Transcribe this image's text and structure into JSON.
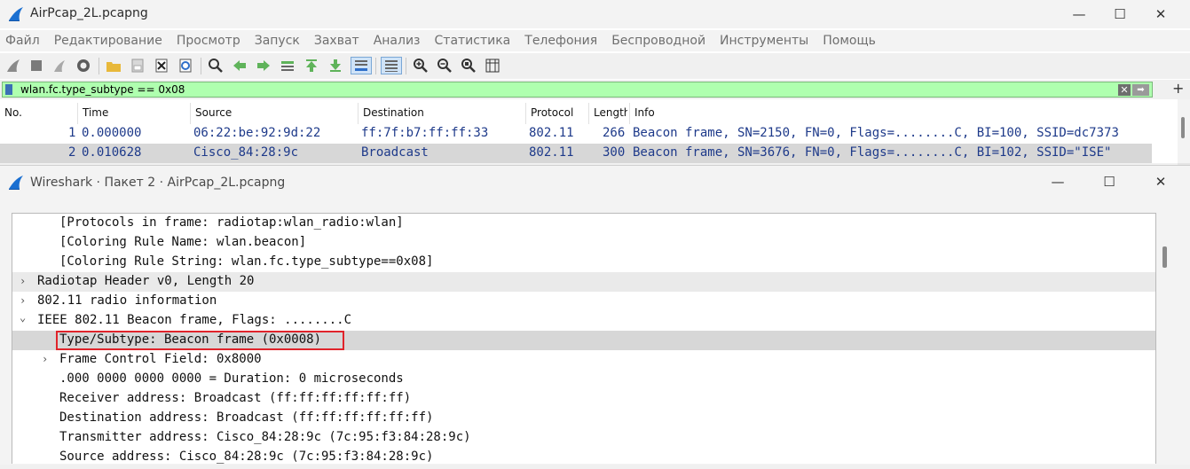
{
  "main_window": {
    "title": "AirPcap_2L.pcapng",
    "controls": {
      "minimize": "—",
      "maximize": "☐",
      "close": "✕"
    }
  },
  "menu": [
    "Файл",
    "Редактирование",
    "Просмотр",
    "Запуск",
    "Захват",
    "Анализ",
    "Статистика",
    "Телефония",
    "Беспроводной",
    "Инструменты",
    "Помощь"
  ],
  "toolbar_icons": [
    "shark-fin-start-icon",
    "stop-icon",
    "restart-icon",
    "capture-options-icon",
    "open-file-icon",
    "save-file-icon",
    "close-file-icon",
    "reload-icon",
    "find-packet-icon",
    "go-back-icon",
    "go-forward-icon",
    "go-to-packet-icon",
    "first-packet-icon",
    "last-packet-icon",
    "autoscroll-icon",
    "colorize-icon",
    "zoom-in-icon",
    "zoom-out-icon",
    "normal-size-icon",
    "resize-columns-icon"
  ],
  "filter": {
    "value": "wlan.fc.type_subtype == 0x08",
    "clear": "✕",
    "apply": "➡",
    "add": "+"
  },
  "packet_list": {
    "columns": [
      "No.",
      "Time",
      "Source",
      "Destination",
      "Protocol",
      "Length",
      "Info"
    ],
    "rows": [
      {
        "no": "1",
        "time": "0.000000",
        "source": "06:22:be:92:9d:22",
        "destination": "ff:7f:b7:ff:ff:33",
        "protocol": "802.11",
        "length": "266",
        "info": "Beacon frame, SN=2150, FN=0, Flags=........C, BI=100, SSID=dc7373"
      },
      {
        "no": "2",
        "time": "0.010628",
        "source": "Cisco_84:28:9c",
        "destination": "Broadcast",
        "protocol": "802.11",
        "length": "300",
        "info": "Beacon frame, SN=3676, FN=0, Flags=........C, BI=102, SSID=\"ISE\""
      }
    ]
  },
  "detail_window": {
    "title": "Wireshark · Пакет 2 · AirPcap_2L.pcapng",
    "controls": {
      "minimize": "—",
      "maximize": "☐",
      "close": "✕"
    },
    "tree": [
      {
        "text": "[Protocols in frame: radiotap:wlan_radio:wlan]",
        "arrow": ""
      },
      {
        "text": "[Coloring Rule Name: wlan.beacon]",
        "arrow": ""
      },
      {
        "text": "[Coloring Rule String: wlan.fc.type_subtype==0x08]",
        "arrow": ""
      },
      {
        "text": "Radiotap Header v0, Length 20",
        "arrow": "›"
      },
      {
        "text": "802.11 radio information",
        "arrow": "›"
      },
      {
        "text": "IEEE 802.11 Beacon frame, Flags: ........C",
        "arrow": "⌄"
      },
      {
        "text": "Type/Subtype: Beacon frame (0x0008)",
        "arrow": ""
      },
      {
        "text": "Frame Control Field: 0x8000",
        "arrow": "›"
      },
      {
        "text": ".000 0000 0000 0000 = Duration: 0 microseconds",
        "arrow": ""
      },
      {
        "text": "Receiver address: Broadcast (ff:ff:ff:ff:ff:ff)",
        "arrow": ""
      },
      {
        "text": "Destination address: Broadcast (ff:ff:ff:ff:ff:ff)",
        "arrow": ""
      },
      {
        "text": "Transmitter address: Cisco_84:28:9c (7c:95:f3:84:28:9c)",
        "arrow": ""
      },
      {
        "text": "Source address: Cisco_84:28:9c (7c:95:f3:84:28:9c)",
        "arrow": ""
      }
    ]
  },
  "colors": {
    "filter_valid": "#afffaf",
    "packet_text": "#1e3a8a",
    "highlight_box": "#e0242b",
    "selected_row": "#d7d7d7"
  }
}
